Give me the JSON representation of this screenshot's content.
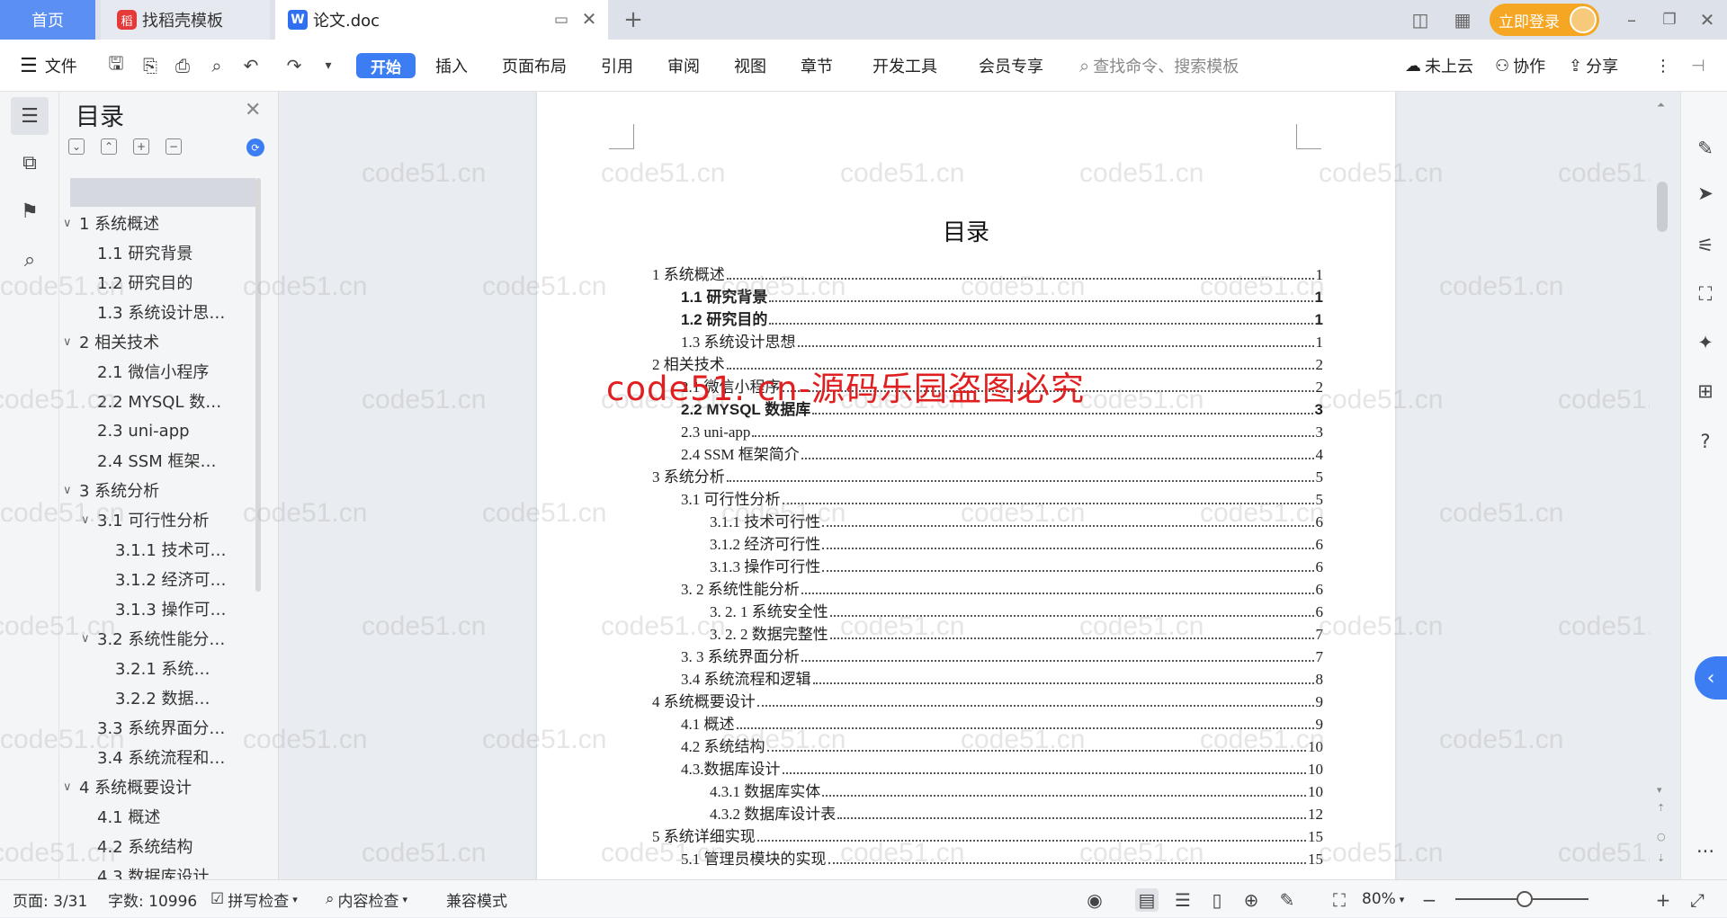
{
  "titlebar": {
    "tabs": [
      {
        "label": "首页"
      },
      {
        "label": "找稻壳模板"
      },
      {
        "label": "论文.doc"
      }
    ],
    "login_label": "立即登录"
  },
  "menubar": {
    "file_label": "文件",
    "items": [
      "开始",
      "插入",
      "页面布局",
      "引用",
      "审阅",
      "视图",
      "章节",
      "开发工具",
      "会员专享"
    ],
    "search_placeholder": "查找命令、搜索模板",
    "cloud_label": "未上云",
    "collab_label": "协作",
    "share_label": "分享"
  },
  "toc_panel": {
    "title": "目录",
    "items": [
      {
        "label": "1 系统概述",
        "level": 1,
        "expandable": true
      },
      {
        "label": "1.1  研究背景",
        "level": 2
      },
      {
        "label": "1.2 研究目的",
        "level": 2
      },
      {
        "label": "1.3 系统设计思…",
        "level": 2
      },
      {
        "label": "2 相关技术",
        "level": 1,
        "expandable": true
      },
      {
        "label": "2.1 微信小程序",
        "level": 2
      },
      {
        "label": "2.2 MYSQL 数…",
        "level": 2
      },
      {
        "label": "2.3 uni-app",
        "level": 2
      },
      {
        "label": "2.4 SSM 框架…",
        "level": 2
      },
      {
        "label": "3 系统分析",
        "level": 1,
        "expandable": true
      },
      {
        "label": "3.1 可行性分析",
        "level": 2,
        "expandable": true
      },
      {
        "label": "3.1.1 技术可…",
        "level": 3
      },
      {
        "label": "3.1.2 经济可…",
        "level": 3
      },
      {
        "label": "3.1.3 操作可…",
        "level": 3
      },
      {
        "label": "3.2 系统性能分…",
        "level": 2,
        "expandable": true
      },
      {
        "label": "3.2.1  系统…",
        "level": 3
      },
      {
        "label": "3.2.2  数据…",
        "level": 3
      },
      {
        "label": "3.3 系统界面分…",
        "level": 2
      },
      {
        "label": "3.4 系统流程和…",
        "level": 2
      },
      {
        "label": "4 系统概要设计",
        "level": 1,
        "expandable": true
      },
      {
        "label": "4.1 概述",
        "level": 2
      },
      {
        "label": "4.2 系统结构",
        "level": 2
      },
      {
        "label": "4.3 数据库设计",
        "level": 2
      }
    ]
  },
  "document": {
    "heading": "目录",
    "toc": [
      {
        "text": "1 系统概述",
        "page": "1",
        "indent": 0
      },
      {
        "text": "1.1  研究背景",
        "page": "1",
        "indent": 1,
        "sans": true
      },
      {
        "text": "1.2 研究目的",
        "page": "1",
        "indent": 1,
        "sans": true
      },
      {
        "text": "1.3 系统设计思想",
        "page": "1",
        "indent": 1
      },
      {
        "text": "2 相关技术",
        "page": "2",
        "indent": 0
      },
      {
        "text": "2.1 微信小程序",
        "page": "2",
        "indent": 1
      },
      {
        "text": "2.2 MYSQL 数据库",
        "page": "3",
        "indent": 1,
        "sans": true
      },
      {
        "text": "2.3 uni-app",
        "page": "3",
        "indent": 1
      },
      {
        "text": "2.4 SSM 框架简介",
        "page": "4",
        "indent": 1
      },
      {
        "text": "3 系统分析",
        "page": "5",
        "indent": 0
      },
      {
        "text": "3.1 可行性分析",
        "page": "5",
        "indent": 1
      },
      {
        "text": "3.1.1 技术可行性",
        "page": "6",
        "indent": 2
      },
      {
        "text": "3.1.2 经济可行性",
        "page": "6",
        "indent": 2
      },
      {
        "text": "3.1.3 操作可行性",
        "page": "6",
        "indent": 2
      },
      {
        "text": "3. 2 系统性能分析",
        "page": "6",
        "indent": 1
      },
      {
        "text": "3. 2. 1  系统安全性",
        "page": "6",
        "indent": 2
      },
      {
        "text": "3. 2. 2  数据完整性",
        "page": "7",
        "indent": 2
      },
      {
        "text": "3. 3 系统界面分析",
        "page": "7",
        "indent": 1
      },
      {
        "text": "3.4 系统流程和逻辑",
        "page": "8",
        "indent": 1
      },
      {
        "text": "4 系统概要设计",
        "page": "9",
        "indent": 0
      },
      {
        "text": "4.1 概述",
        "page": "9",
        "indent": 1
      },
      {
        "text": "4.2 系统结构",
        "page": "10",
        "indent": 1
      },
      {
        "text": "4.3.数据库设计",
        "page": "10",
        "indent": 1
      },
      {
        "text": "4.3.1 数据库实体",
        "page": "10",
        "indent": 2
      },
      {
        "text": "4.3.2 数据库设计表",
        "page": "12",
        "indent": 2
      },
      {
        "text": "5 系统详细实现",
        "page": "15",
        "indent": 0
      },
      {
        "text": "5.1  管理员模块的实现",
        "page": "15",
        "indent": 1
      }
    ],
    "overlay_watermark": "code51. cn-源码乐园盗图必究",
    "bg_watermark": "code51.cn"
  },
  "statusbar": {
    "page": "页面: 3/31",
    "words": "字数: 10996",
    "spell": "拼写检查",
    "content_check": "内容检查",
    "compat": "兼容模式",
    "zoom": "80%"
  },
  "colors": {
    "accent": "#3c7df3",
    "login": "#f5a623",
    "watermark_red": "#e02020"
  }
}
